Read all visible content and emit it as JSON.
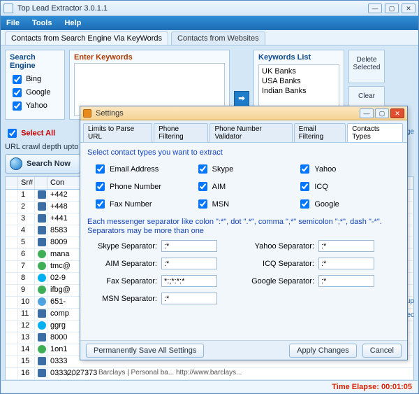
{
  "app": {
    "title": "Top Lead Extractor 3.0.1.1"
  },
  "menu": {
    "file": "File",
    "tools": "Tools",
    "help": "Help"
  },
  "mainTabs": {
    "t1": "Contacts from Search Engine Via KeyWords",
    "t2": "Contacts from Websites"
  },
  "searchEngine": {
    "title": "Search Engine",
    "items": [
      "Bing",
      "Google",
      "Yahoo"
    ]
  },
  "enterKeywords": {
    "title": "Enter Keywords"
  },
  "arrow": "➡",
  "keywordsList": {
    "title": "Keywords List",
    "items": [
      "UK Banks",
      "USA Banks",
      "Indian Banks"
    ]
  },
  "sideButtons": {
    "delete": "Delete Selected",
    "clear": "Clear"
  },
  "selectAll": "Select All",
  "urlCrawl": "URL crawl depth upto",
  "pageLink": "page",
  "searchNow": "Search Now",
  "grid": {
    "headers": {
      "sr": "Sr#",
      "con": "Con"
    },
    "rows": [
      {
        "n": "1",
        "icon": "phone",
        "v": "+442"
      },
      {
        "n": "2",
        "icon": "phone",
        "v": "+448"
      },
      {
        "n": "3",
        "icon": "phone",
        "v": "+441"
      },
      {
        "n": "4",
        "icon": "phone",
        "v": "8583"
      },
      {
        "n": "5",
        "icon": "phone",
        "v": "8009"
      },
      {
        "n": "6",
        "icon": "mail",
        "v": "mana"
      },
      {
        "n": "7",
        "icon": "mail",
        "v": "tmc@"
      },
      {
        "n": "8",
        "icon": "skype",
        "v": "02-9"
      },
      {
        "n": "9",
        "icon": "mail",
        "v": "ifbg@"
      },
      {
        "n": "10",
        "icon": "other",
        "v": "651-"
      },
      {
        "n": "11",
        "icon": "phone",
        "v": "comp"
      },
      {
        "n": "12",
        "icon": "skype",
        "v": "ggrg"
      },
      {
        "n": "13",
        "icon": "phone",
        "v": "8000"
      },
      {
        "n": "14",
        "icon": "mail",
        "v": "1on1"
      },
      {
        "n": "15",
        "icon": "phone",
        "v": "0333"
      },
      {
        "n": "16",
        "icon": "phone",
        "v": "03332027373"
      }
    ]
  },
  "belowGridText": "Barclays | Personal ba...    http://www.barclays...",
  "bgLinks": {
    "backup": "ckup",
    "ec": "ec"
  },
  "status": {
    "timeElapse": "Time Elapse: 00:01:05"
  },
  "settings": {
    "title": "Settings",
    "tabs": [
      "Limits to Parse URL",
      "Phone Filtering",
      "Phone Number Validator",
      "Email Filtering",
      "Contacts Types"
    ],
    "activeTab": "Contacts Types",
    "instruction": "Select contact types you want to extract",
    "types": {
      "email": "Email Address",
      "phone": "Phone Number",
      "fax": "Fax Number",
      "skype": "Skype",
      "aim": "AIM",
      "msn": "MSN",
      "yahoo": "Yahoo",
      "icq": "ICQ",
      "google": "Google"
    },
    "sepHint": "Each messenger separator like colon \":*\", dot \".*\", comma \",*\" semicolon \";*\", dash \"-*\". Separators may be more than one",
    "seps": {
      "skype": {
        "label": "Skype Separator:",
        "value": ":*"
      },
      "aim": {
        "label": "AIM Separator:",
        "value": ":*"
      },
      "fax": {
        "label": "Fax Separator:",
        "value": "*:;*:*:*"
      },
      "msn": {
        "label": "MSN Separator:",
        "value": ":*"
      },
      "yahoo": {
        "label": "Yahoo Separator:",
        "value": ":*"
      },
      "icq": {
        "label": "ICQ Separator:",
        "value": ":*"
      },
      "google": {
        "label": "Google Separator:",
        "value": ":*"
      }
    },
    "buttons": {
      "permSave": "Permanently Save All Settings",
      "apply": "Apply Changes",
      "cancel": "Cancel"
    }
  }
}
